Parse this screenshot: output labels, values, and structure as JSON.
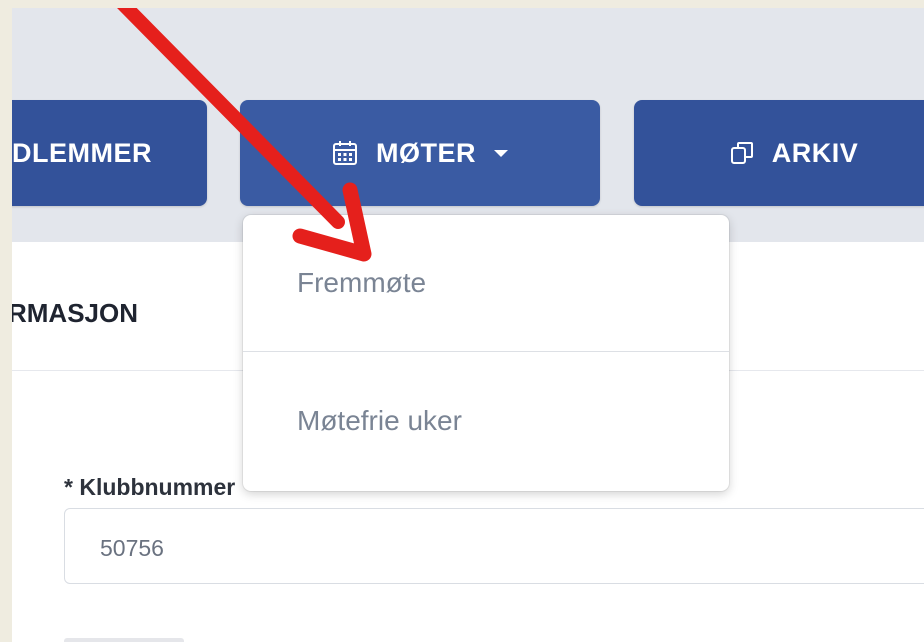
{
  "nav": {
    "members_label": "DLEMMER",
    "meetings_label": "MØTER",
    "archive_label": "ARKIV"
  },
  "section": {
    "title": "RMASJON"
  },
  "dropdown": {
    "items": [
      {
        "label": "Fremmøte"
      },
      {
        "label": "Møtefrie uker"
      }
    ]
  },
  "form": {
    "club_number_label": "* Klubbnummer",
    "club_number_value": "50756"
  },
  "colors": {
    "nav_button": "#33529a",
    "annotation_arrow": "#e5201c",
    "menu_text": "#7a8494"
  },
  "icons": {
    "meetings": "calendar-icon",
    "archive": "archive-copy-icon",
    "dropdown": "caret-down-icon"
  }
}
